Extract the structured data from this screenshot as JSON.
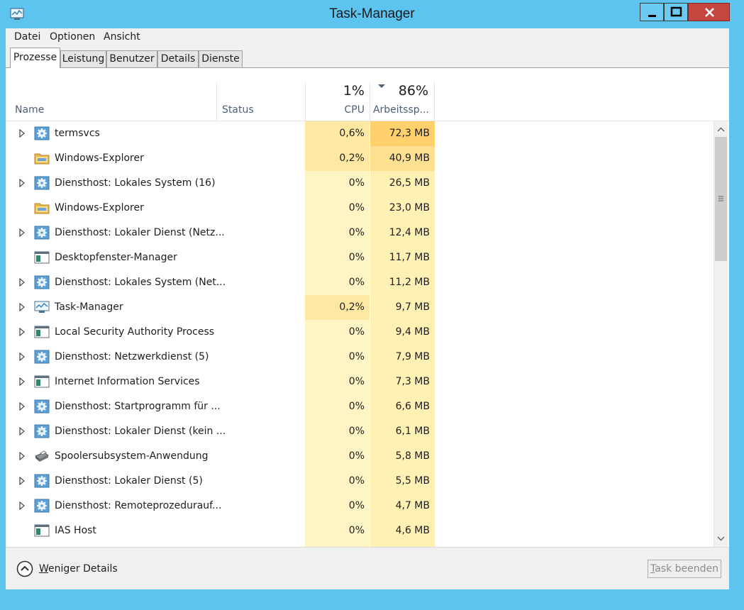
{
  "window": {
    "title": "Task-Manager"
  },
  "menu": [
    "Datei",
    "Optionen",
    "Ansicht"
  ],
  "tabs": [
    "Prozesse",
    "Leistung",
    "Benutzer",
    "Details",
    "Dienste"
  ],
  "columns": {
    "name": "Name",
    "status": "Status",
    "cpu_label": "CPU",
    "cpu_total": "1%",
    "mem_label": "Arbeitssp...",
    "mem_total": "86%"
  },
  "processes": [
    {
      "name": "termsvcs",
      "cpu": "0,6%",
      "mem": "72,3 MB",
      "icon": "gear-icon",
      "expandable": true
    },
    {
      "name": "Windows-Explorer",
      "cpu": "0,2%",
      "mem": "40,9 MB",
      "icon": "folder-icon",
      "expandable": false
    },
    {
      "name": "Diensthost: Lokales System (16)",
      "cpu": "0%",
      "mem": "26,5 MB",
      "icon": "gear-icon",
      "expandable": true
    },
    {
      "name": "Windows-Explorer",
      "cpu": "0%",
      "mem": "23,0 MB",
      "icon": "folder-icon",
      "expandable": false
    },
    {
      "name": "Diensthost: Lokaler Dienst (Netz...",
      "cpu": "0%",
      "mem": "12,4 MB",
      "icon": "gear-icon",
      "expandable": true
    },
    {
      "name": "Desktopfenster-Manager",
      "cpu": "0%",
      "mem": "11,7 MB",
      "icon": "app-window-icon",
      "expandable": false
    },
    {
      "name": "Diensthost: Lokales System (Net...",
      "cpu": "0%",
      "mem": "11,2 MB",
      "icon": "gear-icon",
      "expandable": true
    },
    {
      "name": "Task-Manager",
      "cpu": "0,2%",
      "mem": "9,7 MB",
      "icon": "task-manager-icon",
      "expandable": true
    },
    {
      "name": "Local Security Authority Process",
      "cpu": "0%",
      "mem": "9,4 MB",
      "icon": "app-window-icon",
      "expandable": true
    },
    {
      "name": "Diensthost: Netzwerkdienst (5)",
      "cpu": "0%",
      "mem": "7,9 MB",
      "icon": "gear-icon",
      "expandable": true
    },
    {
      "name": "Internet Information Services",
      "cpu": "0%",
      "mem": "7,3 MB",
      "icon": "app-window-icon",
      "expandable": true
    },
    {
      "name": "Diensthost: Startprogramm für ...",
      "cpu": "0%",
      "mem": "6,6 MB",
      "icon": "gear-icon",
      "expandable": true
    },
    {
      "name": "Diensthost: Lokaler Dienst (kein ...",
      "cpu": "0%",
      "mem": "6,1 MB",
      "icon": "gear-icon",
      "expandable": true
    },
    {
      "name": "Spoolersubsystem-Anwendung",
      "cpu": "0%",
      "mem": "5,8 MB",
      "icon": "printer-icon",
      "expandable": true
    },
    {
      "name": "Diensthost: Lokaler Dienst (5)",
      "cpu": "0%",
      "mem": "5,5 MB",
      "icon": "gear-icon",
      "expandable": true
    },
    {
      "name": "Diensthost: Remoteprozedurauf...",
      "cpu": "0%",
      "mem": "4,7 MB",
      "icon": "gear-icon",
      "expandable": true
    },
    {
      "name": "IAS Host",
      "cpu": "0%",
      "mem": "4,6 MB",
      "icon": "app-window-icon",
      "expandable": false
    }
  ],
  "footer": {
    "fewer_details": "Weniger Details",
    "end_task": "Task beenden"
  },
  "colors": {
    "cpu_light": "#fff4c4",
    "cpu_medium": "#ffe8a3",
    "mem_hot": "#ffd06b",
    "mem_warm": "#ffe090",
    "mem_normal": "#fff0b4",
    "titlebar": "#5cc4ef",
    "close": "#c6463f"
  }
}
